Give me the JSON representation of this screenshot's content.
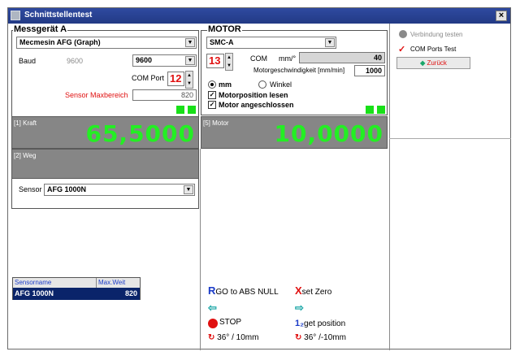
{
  "window": {
    "title": "Schnittstellentest",
    "close": "×"
  },
  "mess": {
    "legend": "Messgerät A",
    "device": "Mecmesin AFG (Graph)",
    "baud_label": "Baud",
    "baud_static": "9600",
    "baud_value": "9600",
    "com_label": "COM Port",
    "com_value": "12",
    "sensor_range_label": "Sensor Maxbereich",
    "sensor_range_value": "820",
    "kraft_label": "[1] Kraft",
    "kraft_value": "65,5000",
    "weg_label": "[2] Weg",
    "sensor_label": "Sensor",
    "sensor_value": "AFG 1000N"
  },
  "motor": {
    "legend": "MOTOR",
    "model": "SMC-A",
    "com_value": "13",
    "com_label": "COM",
    "unit_label": "mm/°",
    "unit_value": "40",
    "speed_label": "Motorgeschwindigkeit [mm/min]",
    "speed_value": "1000",
    "radio_mm": "mm",
    "radio_winkel": "Winkel",
    "check_position": "Motorposition lesen",
    "check_connected": "Motor angeschlossen",
    "motor_label": "[5] Motor",
    "motor_value": "10,0000"
  },
  "table": {
    "headers": [
      "Sensorname",
      "Max.Weit"
    ],
    "rows": [
      [
        "AFG 1000N",
        "820"
      ]
    ]
  },
  "controls": {
    "goto_abs": "GO to ABS NULL",
    "set_zero": "set Zero",
    "stop": "STOP",
    "get_position": "get position",
    "rotate_pos": "36° / 10mm",
    "rotate_neg": "36° /-10mm"
  },
  "side": {
    "verbindung": "Verbindung testen",
    "com_test": "COM Ports Test",
    "zurueck": "Zurück"
  },
  "colors": {
    "title_bar": "#223a85",
    "value_green": "#23ef23",
    "panel_gray": "#868686"
  }
}
